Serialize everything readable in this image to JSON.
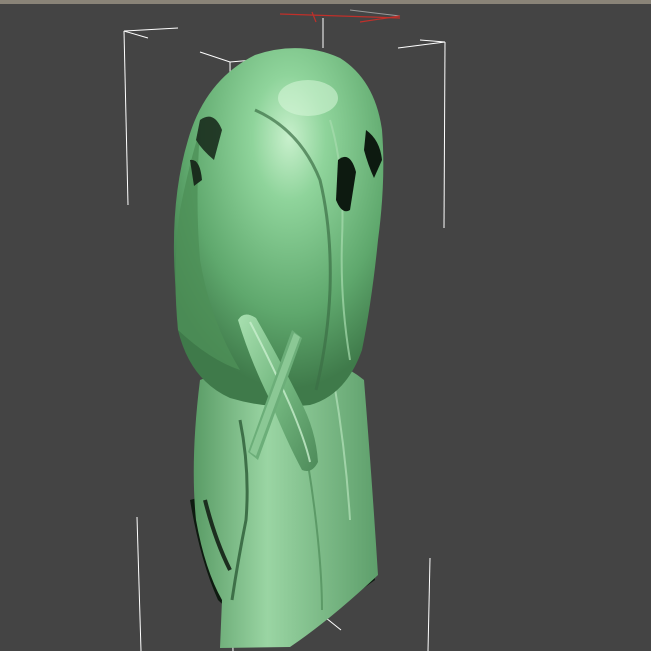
{
  "viewport": {
    "background_color": "#444444",
    "border_color": "#8a8478",
    "selection_bracket_color": "#ffffff",
    "gizmo_axis_color": "#c0302a",
    "object_color": "#7ec48a"
  },
  "icons": [
    "selection-bracket-icon",
    "axis-gizmo-icon"
  ]
}
